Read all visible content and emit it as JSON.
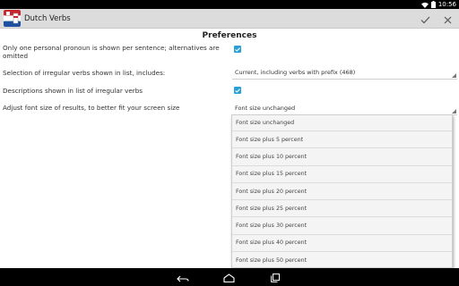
{
  "status_bar": {
    "time": "10:56"
  },
  "app": {
    "title": "Dutch Verbs"
  },
  "preferences": {
    "heading": "Preferences",
    "pronoun_label": "Only one personal pronoun is shown per sentence; alternatives are omitted",
    "irregular_label": "Selection of irregular verbs shown in list, includes:",
    "irregular_value": "Current, including verbs with prefix (468)",
    "descriptions_label": "Descriptions shown in list of irregular verbs",
    "font_label": "Adjust font size of results, to better fit your screen size",
    "font_value": "Font size unchanged"
  },
  "dropdown": {
    "options": [
      "Font size unchanged",
      "Font size plus 5 percent",
      "Font size plus 10 percent",
      "Font size plus 15 percent",
      "Font size plus 20 percent",
      "Font size plus 25 percent",
      "Font size plus 30 percent",
      "Font size plus 40 percent",
      "Font size plus 50 percent"
    ]
  },
  "colors": {
    "accent": "#2aa0d8",
    "action_bar": "#dcdcdc"
  },
  "icons": {
    "confirm": "check-icon",
    "cancel": "close-icon",
    "back": "back-icon",
    "home": "home-icon",
    "recents": "recents-icon"
  }
}
